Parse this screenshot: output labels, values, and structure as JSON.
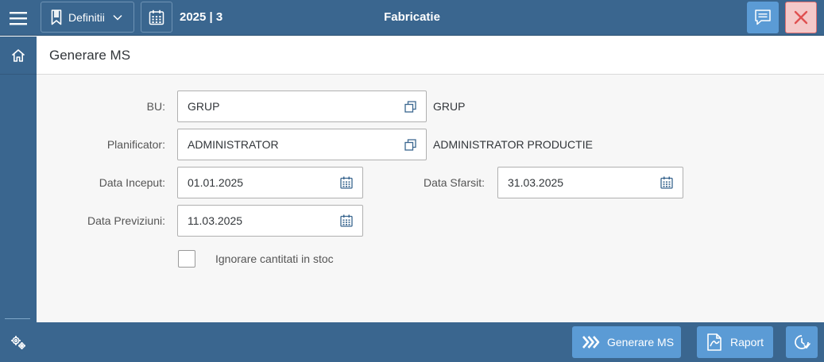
{
  "header": {
    "definitii_label": "Definitii",
    "period": "2025 | 3",
    "app_title": "Fabricatie"
  },
  "page": {
    "title": "Generare MS"
  },
  "form": {
    "bu": {
      "label": "BU:",
      "value": "GRUP",
      "description": "GRUP"
    },
    "planificator": {
      "label": "Planificator:",
      "value": "ADMINISTRATOR",
      "description": "ADMINISTRATOR PRODUCTIE"
    },
    "data_inceput": {
      "label": "Data Inceput:",
      "value": "01.01.2025"
    },
    "data_sfarsit": {
      "label": "Data Sfarsit:",
      "value": "31.03.2025"
    },
    "data_previziuni": {
      "label": "Data Previziuni:",
      "value": "11.03.2025"
    },
    "ignorare_stoc": {
      "label": "Ignorare cantitati in stoc",
      "checked": false
    }
  },
  "footer": {
    "generate_label": "Generare MS",
    "report_label": "Raport"
  },
  "icons": {
    "menu": "hamburger-icon",
    "bookmark": "bookmark-icon",
    "calendar": "calendar-icon",
    "message": "message-icon",
    "close": "close-icon",
    "home": "home-icon",
    "settings": "settings-icon",
    "value_help": "value-help-icon",
    "history": "history-icon",
    "report": "report-icon",
    "forward": "double-chevron-icon"
  },
  "colors": {
    "shell": "#3a668f",
    "accent_button": "#5b9bd5",
    "close_bg": "#f4c9c9",
    "close_x": "#e05050",
    "content_bg": "#f7f7f7"
  }
}
